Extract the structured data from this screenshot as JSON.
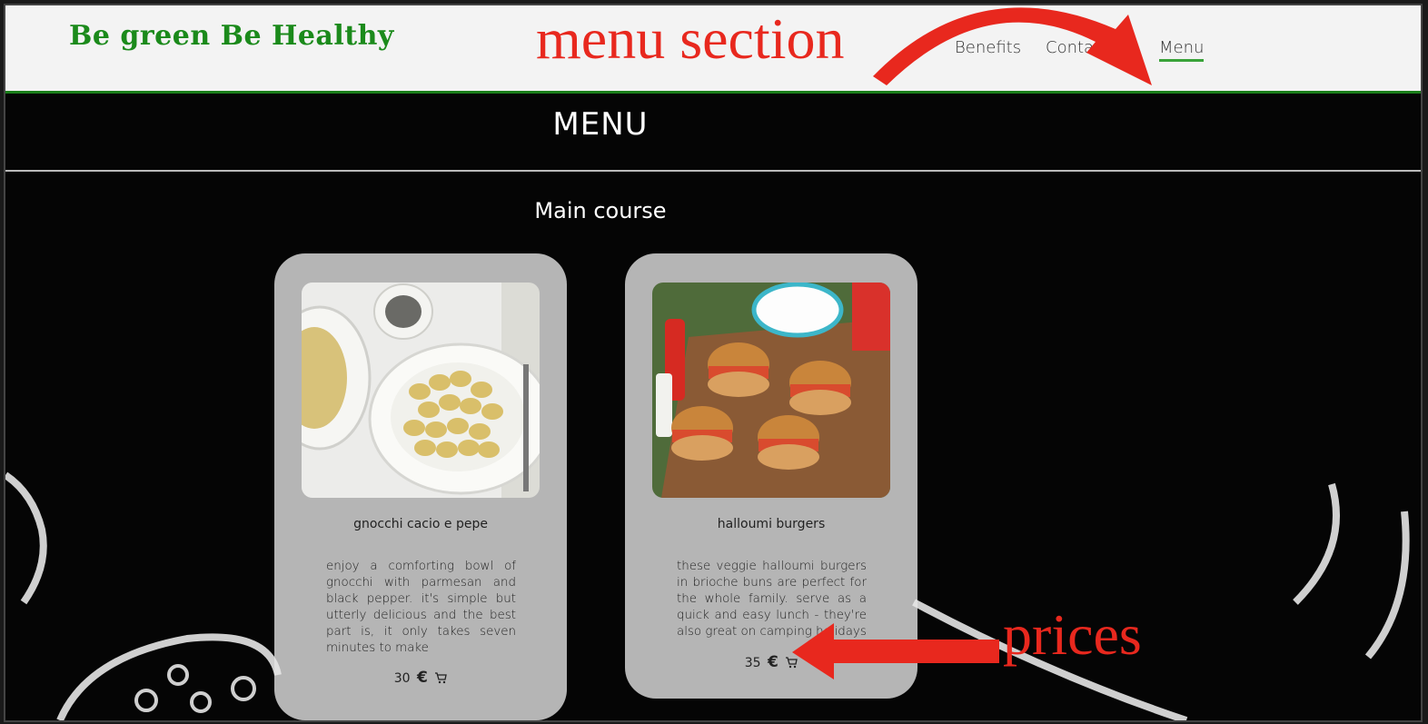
{
  "header": {
    "logo": "Be green Be Healthy",
    "nav": [
      "Benefits",
      "Contacts",
      "Menu"
    ],
    "accent": "#1b8a1b"
  },
  "menu": {
    "title": "MENU",
    "section": "Main course",
    "items": [
      {
        "name": "gnocchi cacio e pepe",
        "description": "enjoy a comforting bowl of gnocchi with parmesan and black pepper. it's simple but utterly delicious and the best part is, it only takes seven minutes to make",
        "price": "30",
        "currency": "€",
        "icon": "cart-icon"
      },
      {
        "name": "halloumi burgers",
        "description": "these veggie halloumi burgers in brioche buns are perfect for the whole family. serve as a quick and easy lunch - they're also great on camping holidays",
        "price": "35",
        "currency": "€",
        "icon": "cart-icon"
      }
    ]
  },
  "annotations": {
    "menu_label": "menu section",
    "prices_label": "prices",
    "color": "#e8281e"
  }
}
